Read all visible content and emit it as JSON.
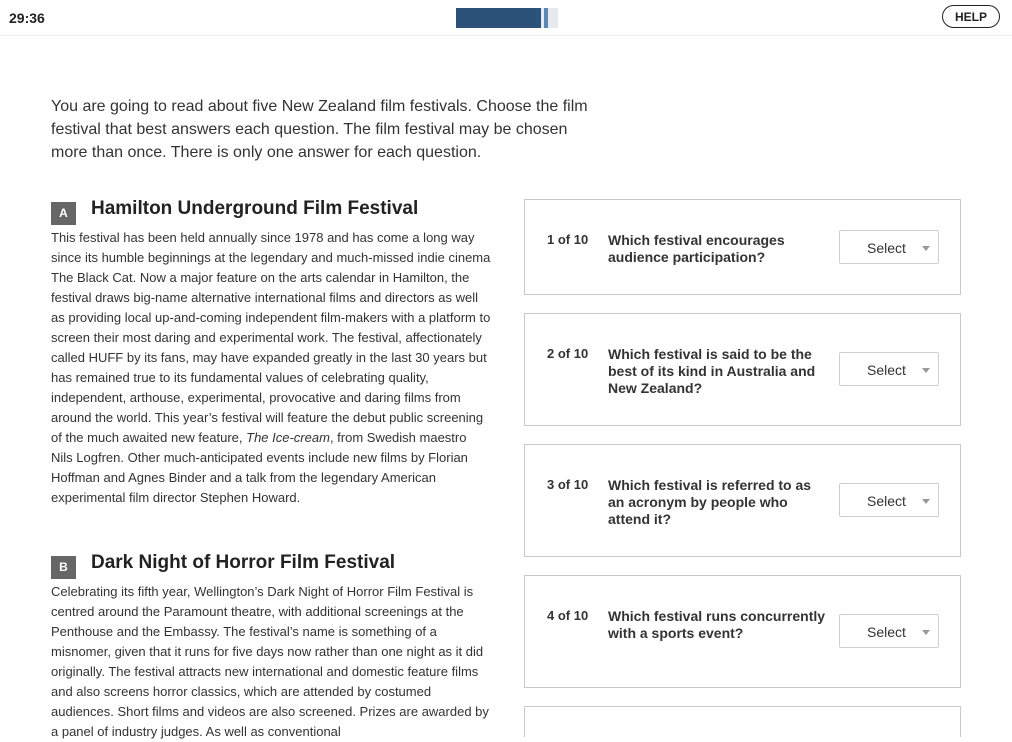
{
  "header": {
    "timer": "29:36",
    "progress_fraction": 0.83,
    "help_label": "HELP"
  },
  "instructions": "You are going to read about five New Zealand film festivals. Choose the film festival that best answers each question. The film festival may be chosen more than once. There is only one answer for each question.",
  "passages": [
    {
      "letter": "A",
      "title": "Hamilton Underground Film Festival",
      "body_before": "This festival has been held annually since 1978 and has come a long way since its humble beginnings at the legendary and much-missed indie cinema The Black Cat. Now a major feature on the arts calendar in Hamilton, the festival draws big-name alternative international films and directors as well as providing local up-and-coming independent film-makers with a platform to screen their most daring and experimental work. The festival, affectionately called HUFF by its fans, may have expanded greatly in the last 30 years but has remained true to its fundamental values of celebrating quality, independent, arthouse, experimental, provocative and daring films from around the world. This year’s festival will feature the debut public screening of the much awaited new feature, ",
      "body_italic": "The Ice-cream",
      "body_after": ", from Swedish maestro Nils Logfren. Other much-anticipated events include new films by Florian Hoffman and Agnes Binder and a talk from the legendary American experimental film director Stephen Howard."
    },
    {
      "letter": "B",
      "title": "Dark Night of Horror Film Festival",
      "body": "Celebrating its fifth year, Wellington’s Dark Night of Horror Film Festival is centred around the Paramount theatre, with additional screenings at the Penthouse and the Embassy. The festival’s name is something of a misnomer, given that it runs for five days now rather than one night as it did originally. The festival attracts new international and domestic feature films and also screens horror classics, which are attended by costumed audiences. Short films and videos are also screened. Prizes are awarded by a panel of industry judges. As well as conventional"
    }
  ],
  "questions": [
    {
      "number": "1 of 10",
      "text": "Which festival encourages audience participation?",
      "select_label": "Select"
    },
    {
      "number": "2 of 10",
      "text": "Which festival is said to be the best of its kind in Australia and New Zealand?",
      "select_label": "Select"
    },
    {
      "number": "3 of 10",
      "text": "Which festival is referred to as an acronym by people who attend it?",
      "select_label": "Select"
    },
    {
      "number": "4 of 10",
      "text": "Which festival runs concurrently with a sports event?",
      "select_label": "Select"
    }
  ],
  "colors": {
    "progress_fill": "#2d5279",
    "badge": "#666666"
  }
}
